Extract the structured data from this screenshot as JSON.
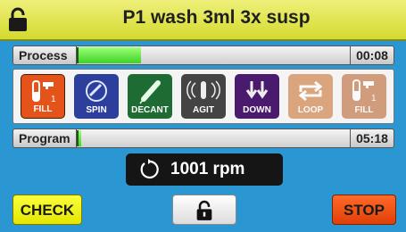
{
  "header": {
    "title": "P1 wash 3ml 3x susp",
    "lock_icon": "padlock-open-icon"
  },
  "process": {
    "label": "Process",
    "time": "00:08",
    "progress": 0.23,
    "fill_color": "#4fdc2a"
  },
  "steps": [
    {
      "label": "FILL",
      "icon": "tube-faucet-icon",
      "color": "#e4531a",
      "state": "active"
    },
    {
      "label": "SPIN",
      "icon": "spin-icon",
      "color": "#2c3f9c",
      "state": "inactive"
    },
    {
      "label": "DECANT",
      "icon": "decant-icon",
      "color": "#1e6b34",
      "state": "inactive"
    },
    {
      "label": "AGIT",
      "icon": "agitate-icon",
      "color": "#444444",
      "state": "inactive"
    },
    {
      "label": "DOWN",
      "icon": "down-arrows-icon",
      "color": "#4a1a6e",
      "state": "inactive"
    },
    {
      "label": "LOOP",
      "icon": "loop-icon",
      "color": "#c5641c",
      "state": "dim"
    },
    {
      "label": "FILL",
      "icon": "tube-faucet-icon",
      "color": "#b5551a",
      "state": "dim"
    }
  ],
  "program": {
    "label": "Program",
    "time": "05:18",
    "progress": 0.01
  },
  "speed": {
    "value": "1001 rpm",
    "icon": "rotate-icon"
  },
  "buttons": {
    "check": "CHECK",
    "lock_icon": "padlock-open-icon",
    "stop": "STOP"
  }
}
